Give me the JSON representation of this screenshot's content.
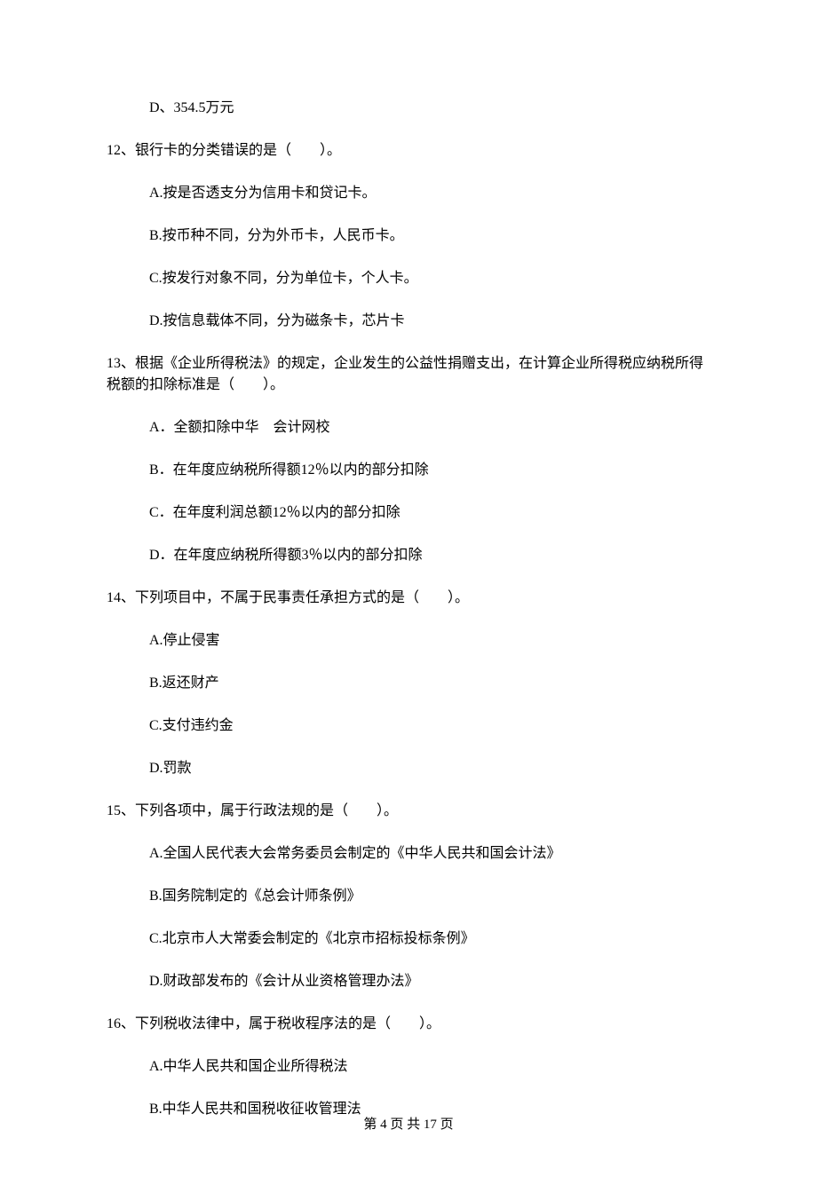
{
  "q11": {
    "options": {
      "D": "D、354.5万元"
    }
  },
  "q12": {
    "stem": "12、银行卡的分类错误的是（　　）。",
    "options": {
      "A": "A.按是否透支分为信用卡和贷记卡。",
      "B": "B.按币种不同，分为外币卡，人民币卡。",
      "C": "C.按发行对象不同，分为单位卡，个人卡。",
      "D": "D.按信息载体不同，分为磁条卡，芯片卡"
    }
  },
  "q13": {
    "stem": "13、根据《企业所得税法》的规定，企业发生的公益性捐赠支出，在计算企业所得税应纳税所得税额的扣除标准是（　　）。",
    "options": {
      "A": "A．全额扣除中华　会计网校",
      "B": "B．在年度应纳税所得额12％以内的部分扣除",
      "C": "C．在年度利润总额12％以内的部分扣除",
      "D": "D．在年度应纳税所得额3％以内的部分扣除"
    }
  },
  "q14": {
    "stem": "14、下列项目中，不属于民事责任承担方式的是（　　）。",
    "options": {
      "A": "A.停止侵害",
      "B": "B.返还财产",
      "C": "C.支付违约金",
      "D": "D.罚款"
    }
  },
  "q15": {
    "stem": "15、下列各项中，属于行政法规的是（　　）。",
    "options": {
      "A": "A.全国人民代表大会常务委员会制定的《中华人民共和国会计法》",
      "B": "B.国务院制定的《总会计师条例》",
      "C": "C.北京市人大常委会制定的《北京市招标投标条例》",
      "D": "D.财政部发布的《会计从业资格管理办法》"
    }
  },
  "q16": {
    "stem": "16、下列税收法律中，属于税收程序法的是（　　）。",
    "options": {
      "A": "A.中华人民共和国企业所得税法",
      "B": "B.中华人民共和国税收征收管理法"
    }
  },
  "footer": "第 4 页 共 17 页"
}
